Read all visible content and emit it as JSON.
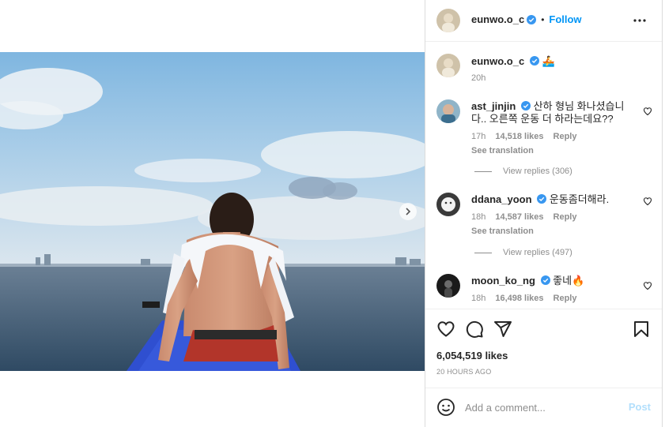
{
  "post": {
    "author": "eunwo.o_c",
    "follow_label": "Follow",
    "dot": "•",
    "caption": {
      "username": "eunwo.o_c",
      "emoji": "🚣",
      "time": "20h"
    },
    "comments": [
      {
        "username": "ast_jinjin",
        "text": "산하 형님 화나셨습니다.. 오른쪽 운동 더 하라는데요??",
        "time": "17h",
        "likes": "14,518 likes",
        "reply": "Reply",
        "see_translation": "See translation",
        "view_replies": "View replies (306)"
      },
      {
        "username": "ddana_yoon",
        "text": "운동좀더해라.",
        "time": "18h",
        "likes": "14,587 likes",
        "reply": "Reply",
        "see_translation": "See translation",
        "view_replies": "View replies (497)"
      },
      {
        "username": "moon_ko_ng",
        "text": "좋네🔥",
        "time": "18h",
        "likes": "16,498 likes",
        "reply": "Reply"
      }
    ],
    "total_likes": "6,054,519 likes",
    "posted_ago": "20 HOURS AGO",
    "comment_placeholder": "Add a comment...",
    "post_label": "Post"
  },
  "colors": {
    "accent": "#0095f6",
    "post_disabled": "#b2dffc",
    "verified": "#3897f0",
    "muted": "#8e8e8e"
  },
  "icons": [
    "more-icon",
    "heart-icon",
    "comment-icon",
    "share-icon",
    "bookmark-icon",
    "emoji-icon",
    "verified-icon",
    "chevron-right-icon"
  ]
}
